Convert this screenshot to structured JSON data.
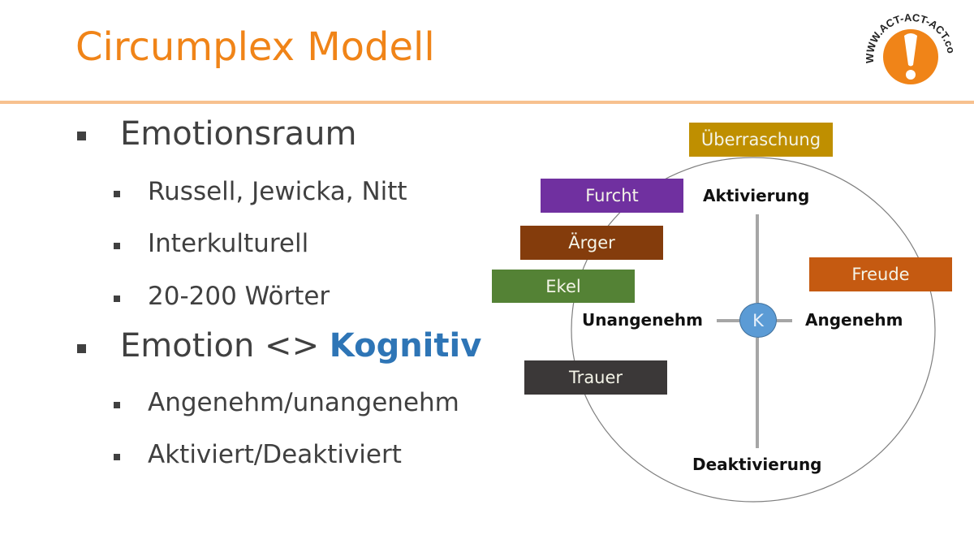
{
  "title": "Circumplex Modell",
  "logo": {
    "text": "WWW.ACT-ACT-ACT.com",
    "symbol": "!",
    "color": "#f08418"
  },
  "bullets": [
    {
      "level": 1,
      "text": "Emotionsraum"
    },
    {
      "level": 2,
      "text": "Russell, Jewicka, Nitt"
    },
    {
      "level": 2,
      "text": "Interkulturell"
    },
    {
      "level": 2,
      "text": "20-200 Wörter"
    },
    {
      "level": 1,
      "text": "Emotion <> ",
      "highlight": "Kognitiv"
    },
    {
      "level": 2,
      "text": "Angenehm/unangenehm"
    },
    {
      "level": 2,
      "text": "Aktiviert/Deaktiviert"
    }
  ],
  "diagram": {
    "axes": {
      "top": "Aktivierung",
      "bottom": "Deaktivierung",
      "left": "Unangenehm",
      "right": "Angenehm",
      "center": "K"
    },
    "emotions": [
      {
        "label": "Überraschung",
        "color": "#bf8f00"
      },
      {
        "label": "Furcht",
        "color": "#7030a0"
      },
      {
        "label": "Ärger",
        "color": "#843c0c"
      },
      {
        "label": "Ekel",
        "color": "#548235"
      },
      {
        "label": "Freude",
        "color": "#c55a11"
      },
      {
        "label": "Trauer",
        "color": "#3b3838"
      }
    ]
  }
}
